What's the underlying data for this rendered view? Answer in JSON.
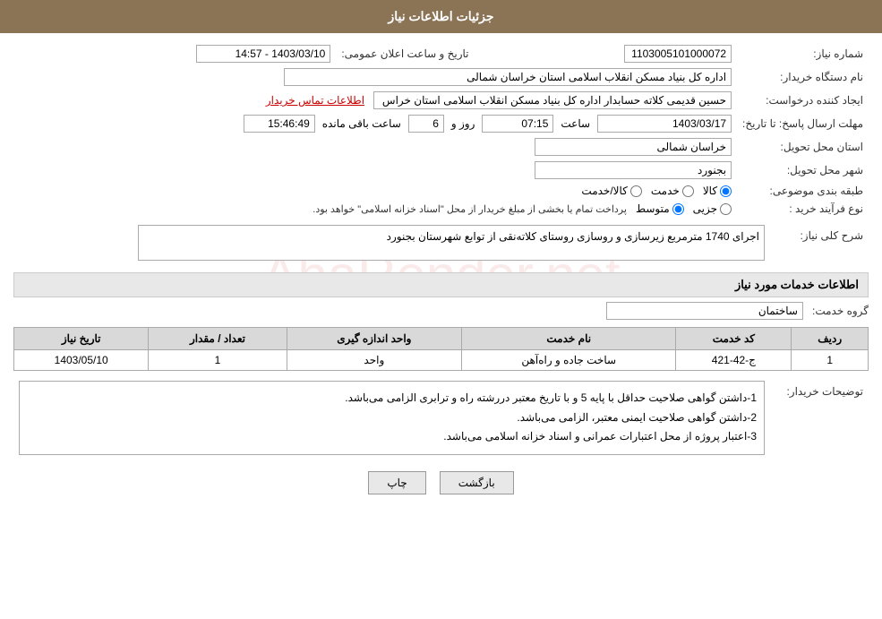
{
  "header": {
    "title": "جزئیات اطلاعات نیاز"
  },
  "info": {
    "shomara_niaz_label": "شماره نیاز:",
    "shomara_niaz_value": "1103005101000072",
    "name_dastgah_label": "نام دستگاه خریدار:",
    "name_dastgah_value": "اداره کل بنیاد مسکن انقلاب اسلامی استان خراسان شمالی",
    "ijad_label": "ایجاد کننده درخواست:",
    "ijad_name": "حسین قدیمی کلاته حسابدار اداره کل بنیاد مسکن انقلاب اسلامی استان خراس",
    "ijad_link": "اطلاعات تماس خریدار",
    "mohlat_label": "مهلت ارسال پاسخ: تا تاریخ:",
    "tarikh_value": "1403/03/17",
    "saat_label": "ساعت",
    "saat_value": "07:15",
    "rooz_label": "روز و",
    "rooz_value": "6",
    "baqi_label": "ساعت باقی مانده",
    "baqi_value": "15:46:49",
    "tarikh_elan_label": "تاریخ و ساعت اعلان عمومی:",
    "tarikh_elan_value": "1403/03/10 - 14:57",
    "ostan_label": "استان محل تحویل:",
    "ostan_value": "خراسان شمالی",
    "shahr_label": "شهر محل تحویل:",
    "shahr_value": "بجنورد",
    "tabaqe_label": "طبقه بندی موضوعی:",
    "tabaqe_options": [
      "کالا",
      "خدمت",
      "کالا/خدمت"
    ],
    "tabaqe_selected": "کالا",
    "feraiend_label": "نوع فرآیند خرید :",
    "feraiend_options": [
      "جزیی",
      "متوسط"
    ],
    "feraiend_selected": "متوسط",
    "feraiend_note": "پرداخت تمام یا بخشی از مبلغ خریدار از محل \"اسناد خزانه اسلامی\" خواهد بود.",
    "sharh_label": "شرح کلی نیاز:",
    "sharh_value": "اجرای 1740 مترمربع زیرسازی و روسازی روستای کلاته‌نقی از توابع شهرستان بجنورد"
  },
  "services_section": {
    "title": "اطلاعات خدمات مورد نیاز",
    "group_label": "گروه خدمت:",
    "group_value": "ساختمان",
    "table": {
      "headers": [
        "ردیف",
        "کد خدمت",
        "نام خدمت",
        "واحد اندازه گیری",
        "تعداد / مقدار",
        "تاریخ نیاز"
      ],
      "rows": [
        {
          "radif": "1",
          "kod": "ج-42-421",
          "name": "ساخت جاده و راه‌آهن",
          "unit": "واحد",
          "quantity": "1",
          "date": "1403/05/10"
        }
      ]
    }
  },
  "description": {
    "label": "توضیحات خریدار:",
    "lines": [
      "1-داشتن گواهی صلاحیت حداقل با پایه 5 و با تاریخ معتبر دررشته راه و ترابری الزامی می‌باشد.",
      "2-داشتن گواهی صلاحیت ایمنی معتبر، الزامی می‌باشد.",
      "3-اعتبار پروژه از محل اعتبارات عمرانی و اسناد خزانه اسلامی می‌باشد."
    ]
  },
  "buttons": {
    "print": "چاپ",
    "back": "بازگشت"
  }
}
